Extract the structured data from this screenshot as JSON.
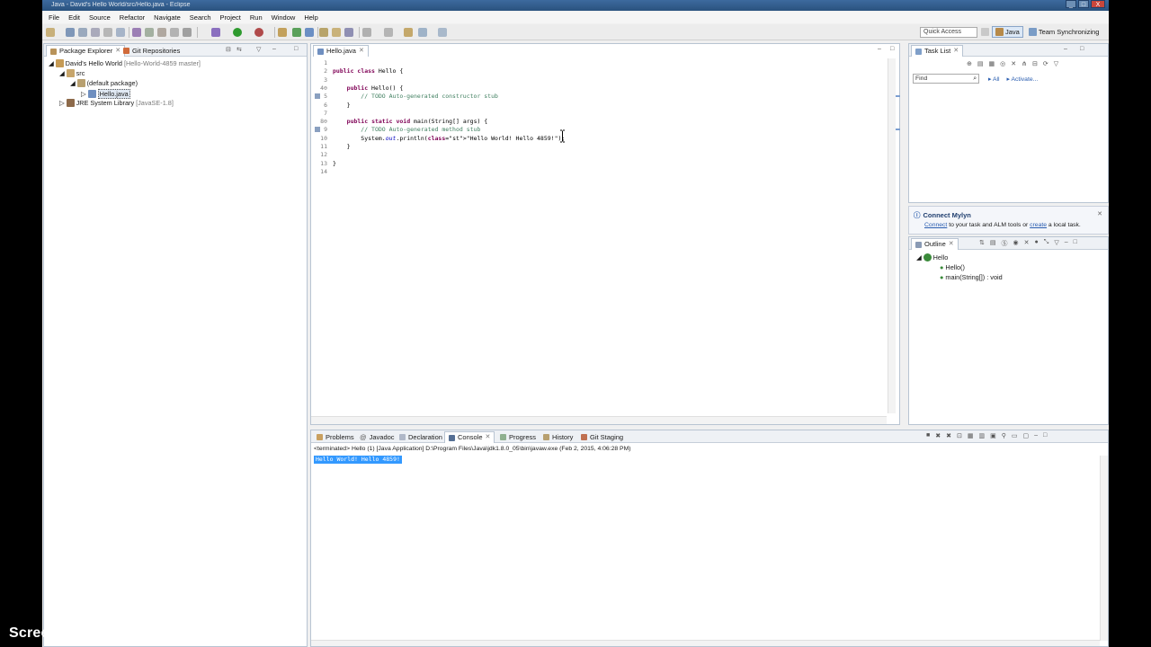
{
  "window": {
    "title": "Java - David's Hello World/src/Hello.java - Eclipse",
    "controls": [
      "_",
      "□",
      "X"
    ]
  },
  "menubar": [
    "File",
    "Edit",
    "Source",
    "Refactor",
    "Navigate",
    "Search",
    "Project",
    "Run",
    "Window",
    "Help"
  ],
  "toolbar": {
    "quick_access_placeholder": "Quick Access",
    "perspectives": [
      "Java",
      "Team Synchronizing"
    ]
  },
  "package_explorer": {
    "tabs": [
      "Package Explorer",
      "Git Repositories"
    ],
    "tree": {
      "project": "David's Hello World",
      "project_decoration": "[Hello-World-4859 master]",
      "src": "src",
      "package": "(default package)",
      "file": "Hello.java",
      "library": "JRE System Library",
      "library_decoration": "[JavaSE-1.8]"
    }
  },
  "editor": {
    "tab": "Hello.java",
    "lines": [
      {
        "n": "1",
        "t": ""
      },
      {
        "n": "2",
        "t": "public class Hello {"
      },
      {
        "n": "3",
        "t": ""
      },
      {
        "n": "4⊖",
        "t": "    public Hello() {"
      },
      {
        "n": "5",
        "t": "        // TODO Auto-generated constructor stub"
      },
      {
        "n": "6",
        "t": "    }"
      },
      {
        "n": "7",
        "t": ""
      },
      {
        "n": "8⊖",
        "t": "    public static void main(String[] args) {"
      },
      {
        "n": "9",
        "t": "        // TODO Auto-generated method stub"
      },
      {
        "n": "10",
        "t": "        System.out.println(\"Hello World! Hello 4859!\");"
      },
      {
        "n": "11",
        "t": "    }"
      },
      {
        "n": "12",
        "t": ""
      },
      {
        "n": "13",
        "t": "}"
      },
      {
        "n": "14",
        "t": ""
      }
    ]
  },
  "task_list": {
    "tab": "Task List",
    "find_placeholder": "Find",
    "filter_all": "All",
    "activate": "Activate..."
  },
  "mylyn": {
    "title": "Connect Mylyn",
    "link_connect": "Connect",
    "text_mid": " to your task and ALM tools or ",
    "link_create": "create",
    "text_end": " a local task."
  },
  "outline": {
    "tab": "Outline",
    "class": "Hello",
    "members": [
      "Hello()",
      "main(String[]) : void"
    ]
  },
  "bottom": {
    "tabs": [
      "Problems",
      "Javadoc",
      "Declaration",
      "Console",
      "Progress",
      "History",
      "Git Staging"
    ],
    "active_tab": "Console",
    "terminated": "<terminated> Hello (1) [Java Application] D:\\Program Files\\Java\\jdk1.8.0_05\\bin\\javaw.exe (Feb 2, 2015, 4:06:28 PM)",
    "output": "Hello World! Hello 4859!"
  },
  "watermark": "Screencast-O-Matic.com"
}
